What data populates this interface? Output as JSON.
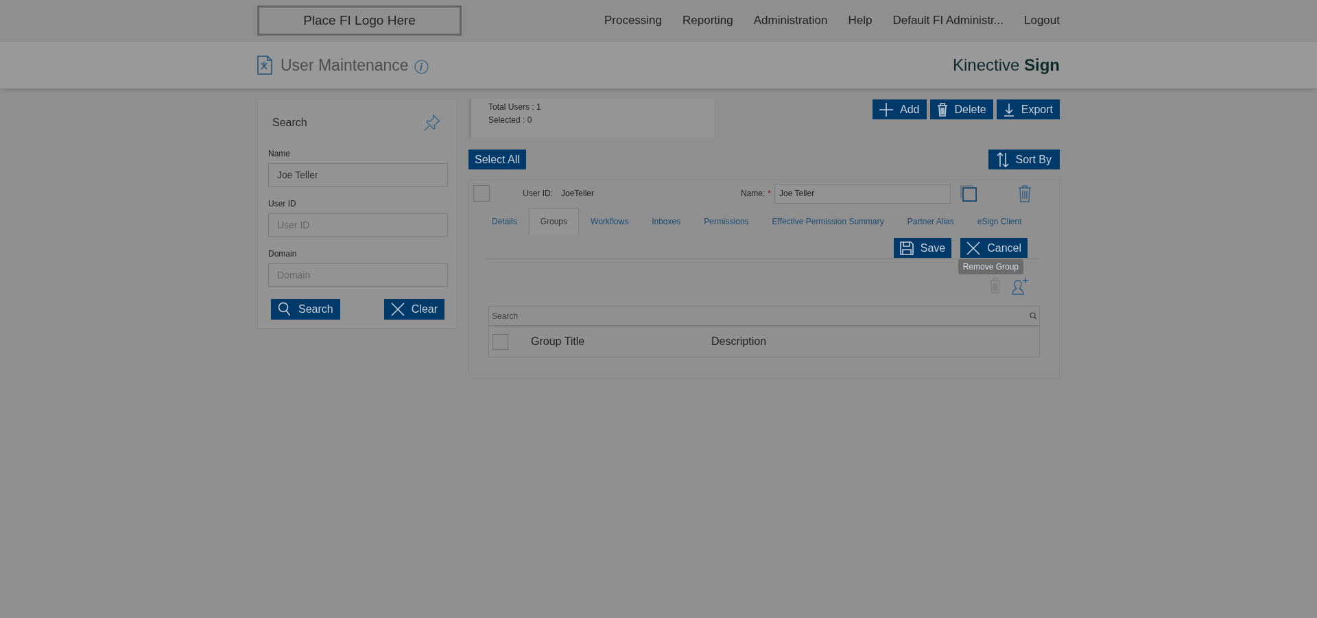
{
  "header": {
    "logo": "Place FI Logo Here",
    "nav": [
      "Processing",
      "Reporting",
      "Administration",
      "Help",
      "Default FI Administr...",
      "Logout"
    ]
  },
  "page": {
    "title": "User Maintenance",
    "brand": {
      "name": "Kinective",
      "strong": "Sign"
    }
  },
  "search_panel": {
    "title": "Search",
    "fields": [
      {
        "label": "Name",
        "value": "Joe Teller"
      },
      {
        "label": "User ID",
        "placeholder": "User ID"
      },
      {
        "label": "Domain",
        "placeholder": "Domain"
      }
    ],
    "buttons": [
      {
        "kind": "search",
        "label": "Search"
      },
      {
        "kind": "clear",
        "label": "Clear"
      }
    ]
  },
  "stats": [
    "Total Users : 1",
    "Selected : 0"
  ],
  "actions": [
    {
      "kind": "add",
      "label": "Add"
    },
    {
      "kind": "delete",
      "label": "Delete"
    },
    {
      "kind": "export",
      "label": "Export"
    }
  ],
  "select_all": "Select All",
  "sort_by": "Sort By",
  "user_card": {
    "checked": false,
    "user_id_label": "User ID:",
    "user_id": "JoeTeller",
    "name_label": "Name:",
    "required_mark": "*",
    "name_value": "Joe Teller",
    "tabs": [
      {
        "label": "Details",
        "selected": false
      },
      {
        "label": "Groups",
        "selected": true
      },
      {
        "label": "Workflows",
        "selected": false
      },
      {
        "label": "Inboxes",
        "selected": false
      },
      {
        "label": "Permissions",
        "selected": false
      },
      {
        "label": "Effective Permission Summary",
        "selected": false
      },
      {
        "label": "Partner Alias",
        "selected": false
      },
      {
        "label": "eSign Client",
        "selected": false
      }
    ],
    "save": "Save",
    "cancel": "Cancel",
    "tooltip": "Remove Group",
    "group_tools": [
      {
        "kind": "remove",
        "disabled": true
      },
      {
        "kind": "add",
        "disabled": false
      }
    ],
    "groups_table": {
      "search_placeholder": "Search",
      "all_checked": false,
      "columns": [
        "Group Title",
        "Description"
      ]
    }
  }
}
